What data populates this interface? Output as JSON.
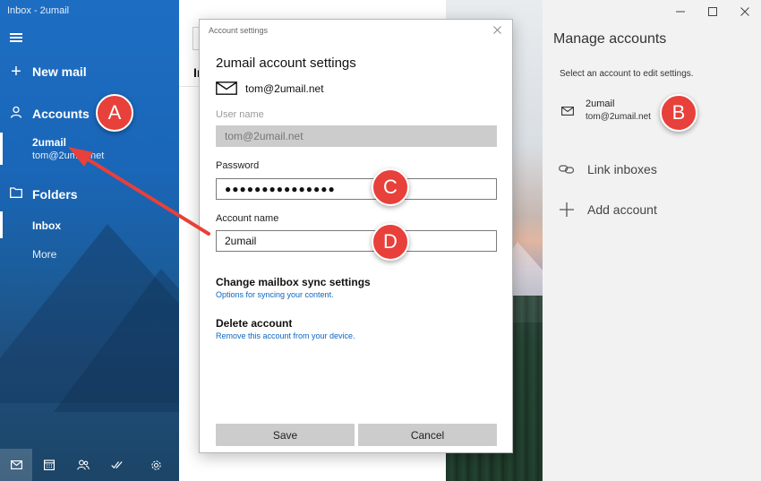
{
  "window": {
    "title": "Inbox - 2umail"
  },
  "nav": {
    "new_mail": "New mail",
    "accounts": "Accounts",
    "account_name": "2umail",
    "account_email": "tom@2umail.net",
    "folders": "Folders",
    "inbox": "Inbox",
    "more": "More"
  },
  "message_list": {
    "header": "In"
  },
  "dialog": {
    "title": "Account settings",
    "heading": "2umail account settings",
    "email": "tom@2umail.net",
    "username_label": "User name",
    "username_value": "tom@2umail.net",
    "password_label": "Password",
    "password_value": "●●●●●●●●●●●●●●●",
    "account_name_label": "Account name",
    "account_name_value": "2umail",
    "sync_title": "Change mailbox sync settings",
    "sync_desc": "Options for syncing your content.",
    "delete_title": "Delete account",
    "delete_desc": "Remove this account from your device.",
    "save_label": "Save",
    "cancel_label": "Cancel"
  },
  "manage": {
    "title": "Manage accounts",
    "hint": "Select an account to edit settings.",
    "account_name": "2umail",
    "account_email": "tom@2umail.net",
    "link_inboxes": "Link inboxes",
    "add_account": "Add account"
  },
  "callouts": {
    "a": "A",
    "b": "B",
    "c": "C",
    "d": "D"
  },
  "colors": {
    "accent": "#1a66b8",
    "callout": "#e8403a",
    "link": "#0a66c2"
  }
}
